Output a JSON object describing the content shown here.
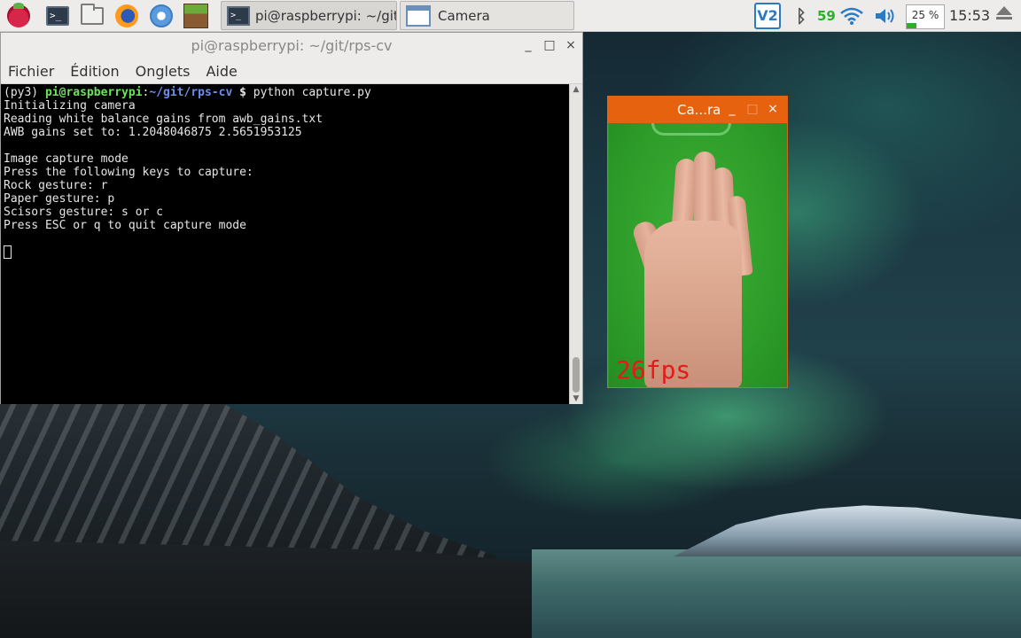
{
  "taskbar": {
    "launchers": [
      {
        "name": "raspberry-menu",
        "icon": "raspberry-pi-icon"
      },
      {
        "name": "terminal-launcher",
        "icon": "terminal-icon"
      },
      {
        "name": "file-manager-launcher",
        "icon": "folder-icon"
      },
      {
        "name": "firefox-launcher",
        "icon": "firefox-icon"
      },
      {
        "name": "chromium-launcher",
        "icon": "chromium-icon"
      },
      {
        "name": "minecraft-launcher",
        "icon": "minecraft-icon"
      }
    ],
    "tasks": [
      {
        "label": "pi@raspberrypi: ~/git",
        "active": true,
        "icon": "terminal-icon"
      },
      {
        "label": "Camera",
        "active": false,
        "icon": "window-icon"
      }
    ],
    "tray": {
      "vnc_label": "V2",
      "cpu_value": "59",
      "battery_label": "25 %",
      "battery_percent": 25,
      "clock": "15:53"
    }
  },
  "terminal": {
    "title": "pi@raspberrypi: ~/git/rps-cv",
    "menu": [
      "Fichier",
      "Édition",
      "Onglets",
      "Aide"
    ],
    "prompt": {
      "env": "(py3) ",
      "user": "pi@raspberrypi",
      "sep": ":",
      "path": "~/git/rps-cv",
      "symbol": " $ ",
      "command": "python capture.py"
    },
    "lines": [
      "Initializing camera",
      "Reading white balance gains from awb_gains.txt",
      "AWB gains set to: 1.2048046875 2.5651953125",
      "",
      "Image capture mode",
      "Press the following keys to capture:",
      "Rock gesture: r",
      "Paper gesture: p",
      "Scisors gesture: s or c",
      "Press ESC or q to quit capture mode",
      ""
    ],
    "controls": {
      "minimize": "_",
      "maximize": "□",
      "close": "×"
    }
  },
  "camera": {
    "title": "Ca...ra",
    "fps": "26fps",
    "controls": {
      "minimize": "_",
      "maximize": "□",
      "close": "×"
    }
  },
  "colors": {
    "camera_titlebar": "#e6620f",
    "prompt_user": "#6de35b",
    "prompt_path": "#6a8ff0",
    "fps_text": "#e51a1a"
  }
}
